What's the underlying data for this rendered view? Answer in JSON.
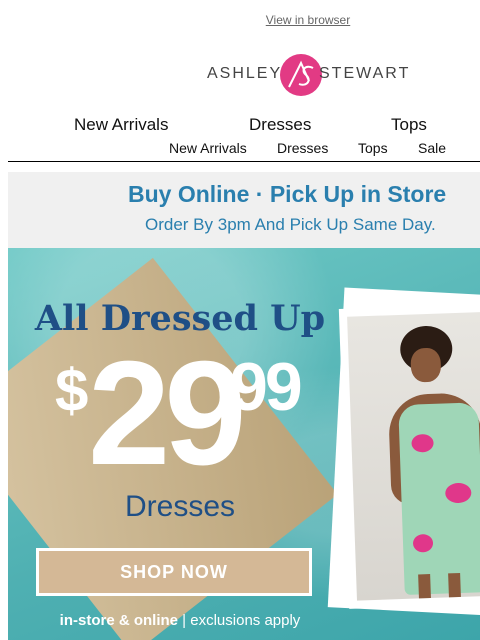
{
  "header": {
    "view_in_browser": "View in browser",
    "logo_left": "ASHLEY",
    "logo_right": "STEWART"
  },
  "nav_primary": [
    "New Arrivals",
    "Dresses",
    "Tops"
  ],
  "nav_secondary": [
    "New Arrivals",
    "Dresses",
    "Tops",
    "Sale"
  ],
  "pickup_banner": {
    "line1": "Buy Online · Pick Up in Store",
    "line2": "Order By 3pm And Pick Up Same Day."
  },
  "hero": {
    "headline": "All Dressed Up",
    "currency": "$",
    "price_whole": "29",
    "price_cents": "99",
    "category": "Dresses",
    "cta": "SHOP NOW",
    "footnote_bold": "in-store & online",
    "footnote_rest": " | exclusions apply"
  },
  "colors": {
    "brand_pink": "#e23a84",
    "link_blue": "#2a7fae",
    "navy": "#1f4f86",
    "cta_tan": "#d4b896",
    "pool_teal": "#55b6b5"
  }
}
